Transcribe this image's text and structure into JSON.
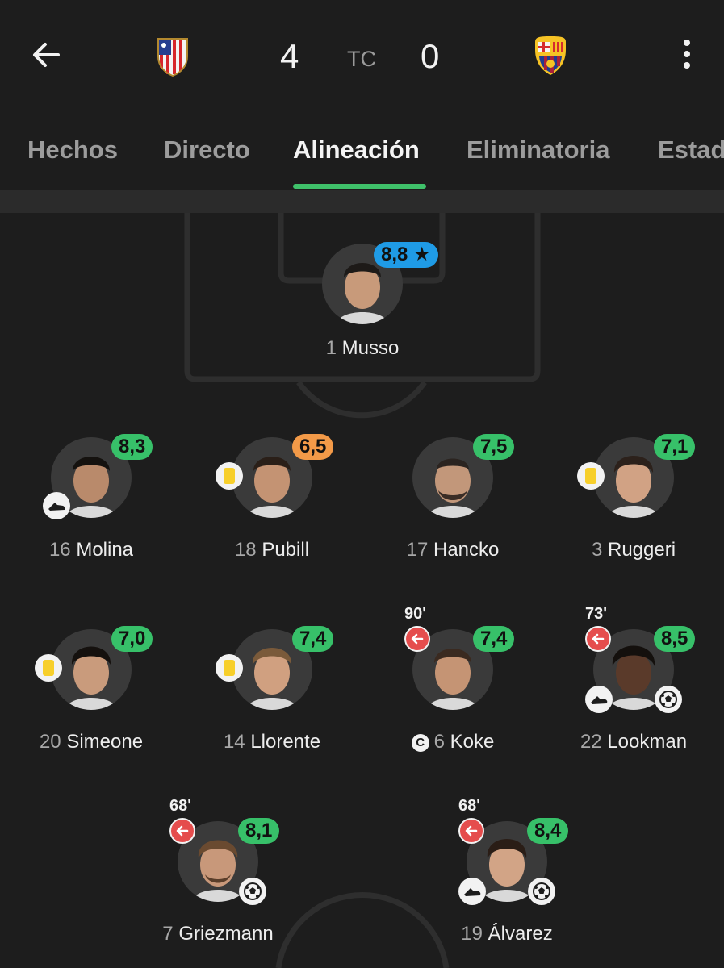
{
  "header": {
    "back_icon": "arrow-left-icon",
    "home_crest": "atletico-madrid-crest",
    "home_score": "4",
    "status": "TC",
    "away_score": "0",
    "away_crest": "fc-barcelona-crest",
    "menu_icon": "more-vertical-icon"
  },
  "tabs": [
    {
      "label": "Hechos"
    },
    {
      "label": "Directo"
    },
    {
      "label": "Alineación",
      "active": true
    },
    {
      "label": "Eliminatoria"
    },
    {
      "label": "Estad"
    }
  ],
  "colors": {
    "background": "#1d1d1d",
    "rating_green": "#37c069",
    "rating_orange": "#f39a48",
    "rating_blue": "#1f9be6",
    "tab_indicator": "#3fc16a",
    "sub_red": "#e54d4d",
    "yellow_card": "#f7cf2a"
  },
  "players": [
    {
      "number": "1",
      "name": "Musso",
      "rating": "8,8",
      "rating_color": "blue",
      "star": true
    },
    {
      "number": "16",
      "name": "Molina",
      "rating": "8,3",
      "rating_color": "green",
      "assist": true
    },
    {
      "number": "18",
      "name": "Pubill",
      "rating": "6,5",
      "rating_color": "orange",
      "yellow_card": true
    },
    {
      "number": "17",
      "name": "Hancko",
      "rating": "7,5",
      "rating_color": "green"
    },
    {
      "number": "3",
      "name": "Ruggeri",
      "rating": "7,1",
      "rating_color": "green",
      "yellow_card": true
    },
    {
      "number": "20",
      "name": "Simeone",
      "rating": "7,0",
      "rating_color": "green",
      "yellow_card": true
    },
    {
      "number": "14",
      "name": "Llorente",
      "rating": "7,4",
      "rating_color": "green",
      "yellow_card": true
    },
    {
      "number": "6",
      "name": "Koke",
      "rating": "7,4",
      "rating_color": "green",
      "sub_minute": "90'",
      "captain": true,
      "captain_mark": "C"
    },
    {
      "number": "22",
      "name": "Lookman",
      "rating": "8,5",
      "rating_color": "green",
      "sub_minute": "73'",
      "assist": true,
      "goal": true
    },
    {
      "number": "7",
      "name": "Griezmann",
      "rating": "8,1",
      "rating_color": "green",
      "sub_minute": "68'",
      "goal": true
    },
    {
      "number": "19",
      "name": "Álvarez",
      "rating": "8,4",
      "rating_color": "green",
      "sub_minute": "68'",
      "assist": true,
      "goal": true
    }
  ]
}
